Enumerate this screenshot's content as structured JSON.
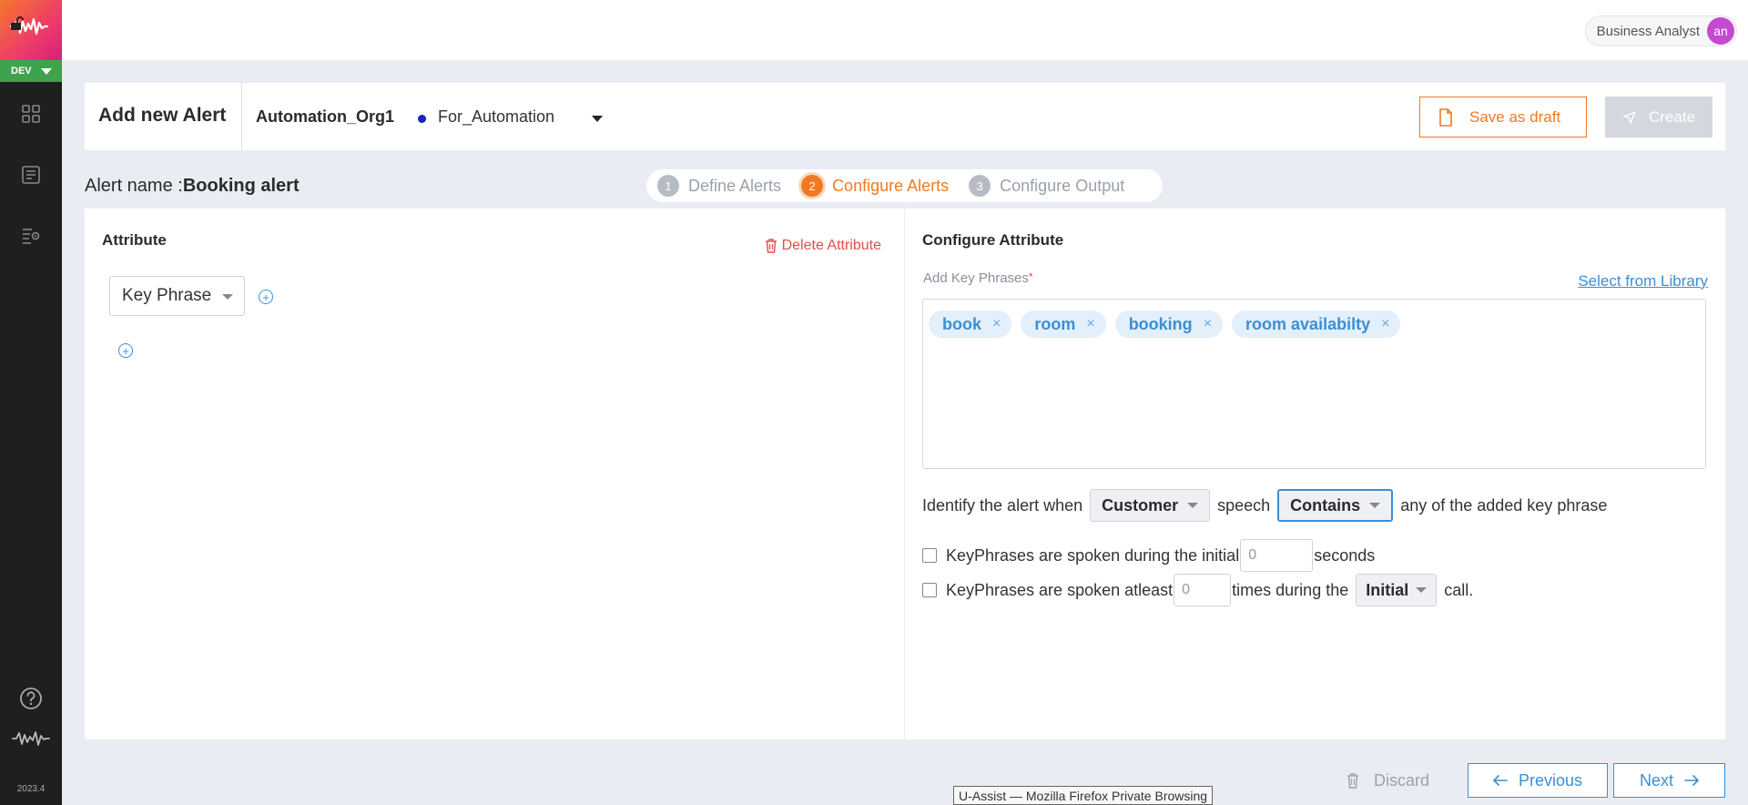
{
  "sidebar": {
    "env_label": "DEV",
    "version": "2023.4",
    "icons": [
      "dashboard-icon",
      "document-list-icon",
      "settings-list-icon",
      "help-icon",
      "brand-wave-icon"
    ]
  },
  "topbar": {
    "user_role": "Business Analyst",
    "avatar_initials": "an"
  },
  "header": {
    "title": "Add new Alert",
    "org": "Automation_Org1",
    "project": "For_Automation",
    "save_draft_label": "Save as draft",
    "create_label": "Create"
  },
  "alert": {
    "name_label": "Alert name :",
    "name_value": "Booking alert"
  },
  "stepper": {
    "steps": [
      {
        "num": "1",
        "label": "Define Alerts"
      },
      {
        "num": "2",
        "label": "Configure Alerts"
      },
      {
        "num": "3",
        "label": "Configure Output"
      }
    ],
    "active_step": 2
  },
  "attribute_panel": {
    "title": "Attribute",
    "delete_label": "Delete Attribute",
    "attribute_type": "Key Phrase"
  },
  "configure_panel": {
    "title": "Configure Attribute",
    "key_phrases_label": "Add Key Phrases",
    "required_mark": "*",
    "library_link": "Select from Library",
    "key_phrases": [
      "book",
      "room",
      "booking",
      "room availabilty"
    ],
    "remove_glyph": "×",
    "identify_prefix": "Identify the alert when",
    "speaker": "Customer",
    "speech_word": "speech",
    "match_type": "Contains",
    "identify_suffix": "any of the added key phrase",
    "option1_text": "KeyPhrases are spoken during the initial",
    "option1_value": "0",
    "option1_suffix": "seconds",
    "option2_text": "KeyPhrases are spoken atleast",
    "option2_value": "0",
    "option2_mid": "times during the",
    "option2_period": "Initial",
    "option2_suffix": "call."
  },
  "footer": {
    "discard_label": "Discard",
    "previous_label": "Previous",
    "next_label": "Next",
    "tooltip": "U-Assist — Mozilla Firefox Private Browsing"
  },
  "colors": {
    "accent_orange": "#f07a22",
    "accent_blue": "#3a8fd6",
    "danger_red": "#e64a4a",
    "env_green": "#3fa34d"
  }
}
